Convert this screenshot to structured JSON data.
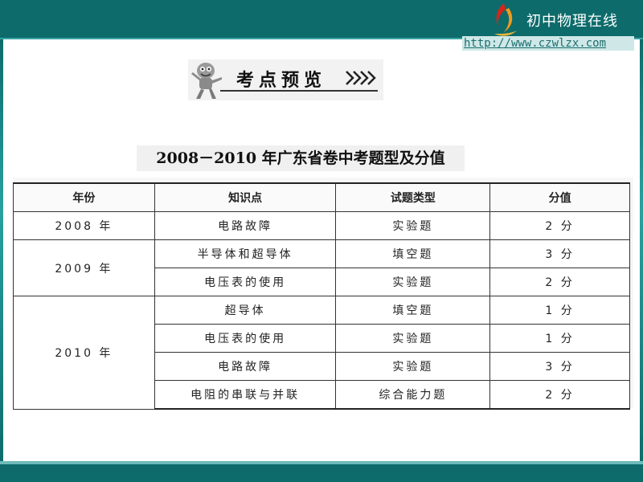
{
  "brand": {
    "name": "初中物理在线",
    "url": "http://www.czwlzx.com"
  },
  "banner": {
    "title": "考点预览"
  },
  "table": {
    "caption": "2008－2010 年广东省卷中考题型及分值",
    "headers": [
      "年份",
      "知识点",
      "试题类型",
      "分值"
    ],
    "groups": [
      {
        "year": "2008 年",
        "rows": [
          {
            "point": "电路故障",
            "type": "实验题",
            "score": "2 分"
          }
        ]
      },
      {
        "year": "2009 年",
        "rows": [
          {
            "point": "半导体和超导体",
            "type": "填空题",
            "score": "3 分"
          },
          {
            "point": "电压表的使用",
            "type": "实验题",
            "score": "2 分"
          }
        ]
      },
      {
        "year": "2010 年",
        "rows": [
          {
            "point": "超导体",
            "type": "填空题",
            "score": "1 分"
          },
          {
            "point": "电压表的使用",
            "type": "实验题",
            "score": "1 分"
          },
          {
            "point": "电路故障",
            "type": "实验题",
            "score": "3 分"
          },
          {
            "point": "电阻的串联与并联",
            "type": "综合能力题",
            "score": "2 分"
          }
        ]
      }
    ]
  },
  "colors": {
    "band": "#0d6b6b",
    "accent_red": "#d0271b",
    "accent_orange": "#f29a1d"
  }
}
